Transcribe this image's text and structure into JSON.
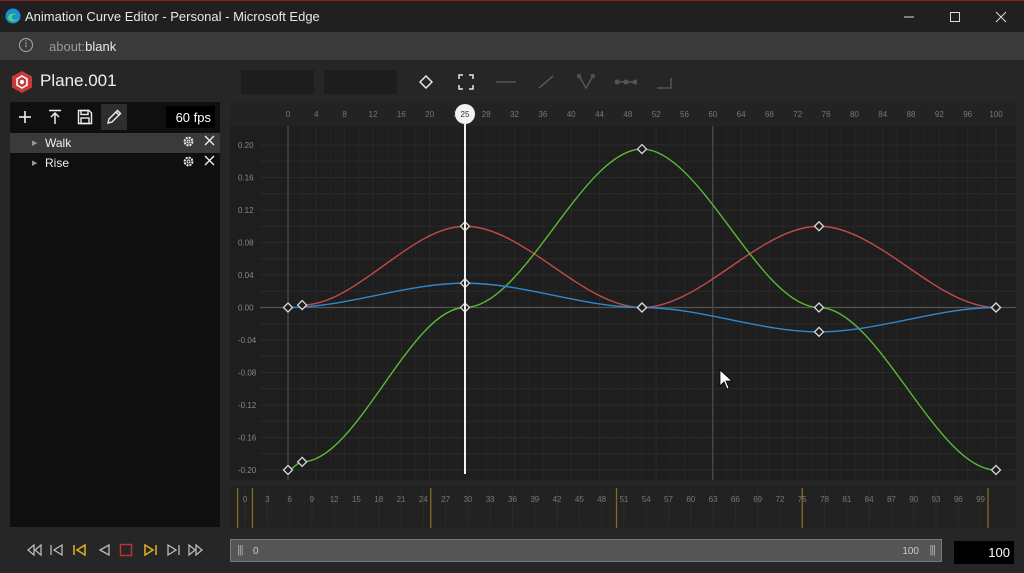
{
  "window": {
    "title": "Animation Curve Editor - Personal - Microsoft Edge",
    "minimize_icon": "minimize-icon",
    "maximize_icon": "maximize-icon",
    "close_icon": "close-icon"
  },
  "address_bar": {
    "info_glyph": "i",
    "scheme": "about:",
    "host": "blank"
  },
  "header": {
    "object_name": "Plane.001",
    "tools": [
      "diamond-key-icon",
      "frame-all-icon",
      "flat-tangent-icon",
      "linear-tangent-icon",
      "broken-tangent-icon",
      "free-tangent-icon",
      "step-tangent-icon"
    ]
  },
  "left_panel": {
    "fps": "60 fps",
    "animations": [
      {
        "name": "Walk",
        "selected": true
      },
      {
        "name": "Rise",
        "selected": false
      }
    ]
  },
  "graph": {
    "playhead": "25",
    "x_ticks": [
      "0",
      "4",
      "8",
      "12",
      "16",
      "20",
      "24",
      "28",
      "32",
      "36",
      "40",
      "44",
      "48",
      "52",
      "56",
      "60",
      "64",
      "68",
      "72",
      "76",
      "80",
      "84",
      "88",
      "92",
      "96",
      "100"
    ],
    "y_ticks": [
      "0.20",
      "0.16",
      "0.12",
      "0.08",
      "0.04",
      "0.00",
      "-0.04",
      "-0.08",
      "-0.12",
      "-0.16",
      "-0.20"
    ],
    "colors": {
      "red": "#c24a4a",
      "green": "#5ab836",
      "blue": "#2e88d0"
    }
  },
  "chart_data": {
    "type": "line",
    "xlim": [
      0,
      100
    ],
    "ylim": [
      -0.2,
      0.2
    ],
    "series": [
      {
        "color": "#c24a4a",
        "keys": [
          [
            2,
            0.003
          ],
          [
            25,
            0.1
          ],
          [
            50,
            0.0
          ],
          [
            75,
            0.1
          ],
          [
            100,
            0.0
          ]
        ]
      },
      {
        "color": "#5ab836",
        "keys": [
          [
            0,
            -0.2
          ],
          [
            2,
            -0.19
          ],
          [
            25,
            0.0
          ],
          [
            50,
            0.195
          ],
          [
            75,
            0.0
          ],
          [
            100,
            -0.2
          ]
        ]
      },
      {
        "color": "#2e88d0",
        "keys": [
          [
            0,
            0.0
          ],
          [
            25,
            0.03
          ],
          [
            50,
            0.0
          ],
          [
            75,
            -0.03
          ],
          [
            100,
            0.0
          ]
        ]
      }
    ]
  },
  "timeline": {
    "ticks": [
      "0",
      "3",
      "6",
      "9",
      "12",
      "15",
      "18",
      "21",
      "24",
      "27",
      "30",
      "33",
      "36",
      "39",
      "42",
      "45",
      "48",
      "51",
      "54",
      "57",
      "60",
      "63",
      "66",
      "69",
      "72",
      "75",
      "78",
      "81",
      "84",
      "87",
      "90",
      "93",
      "96",
      "99"
    ],
    "range_start": "0",
    "range_end": "100",
    "end_frame": "100"
  },
  "transport": {
    "buttons": [
      "rewind-start-icon",
      "prev-key-icon",
      "prev-marker-icon",
      "play-reverse-icon",
      "stop-icon",
      "play-icon",
      "next-key-icon",
      "fast-forward-icon"
    ]
  }
}
